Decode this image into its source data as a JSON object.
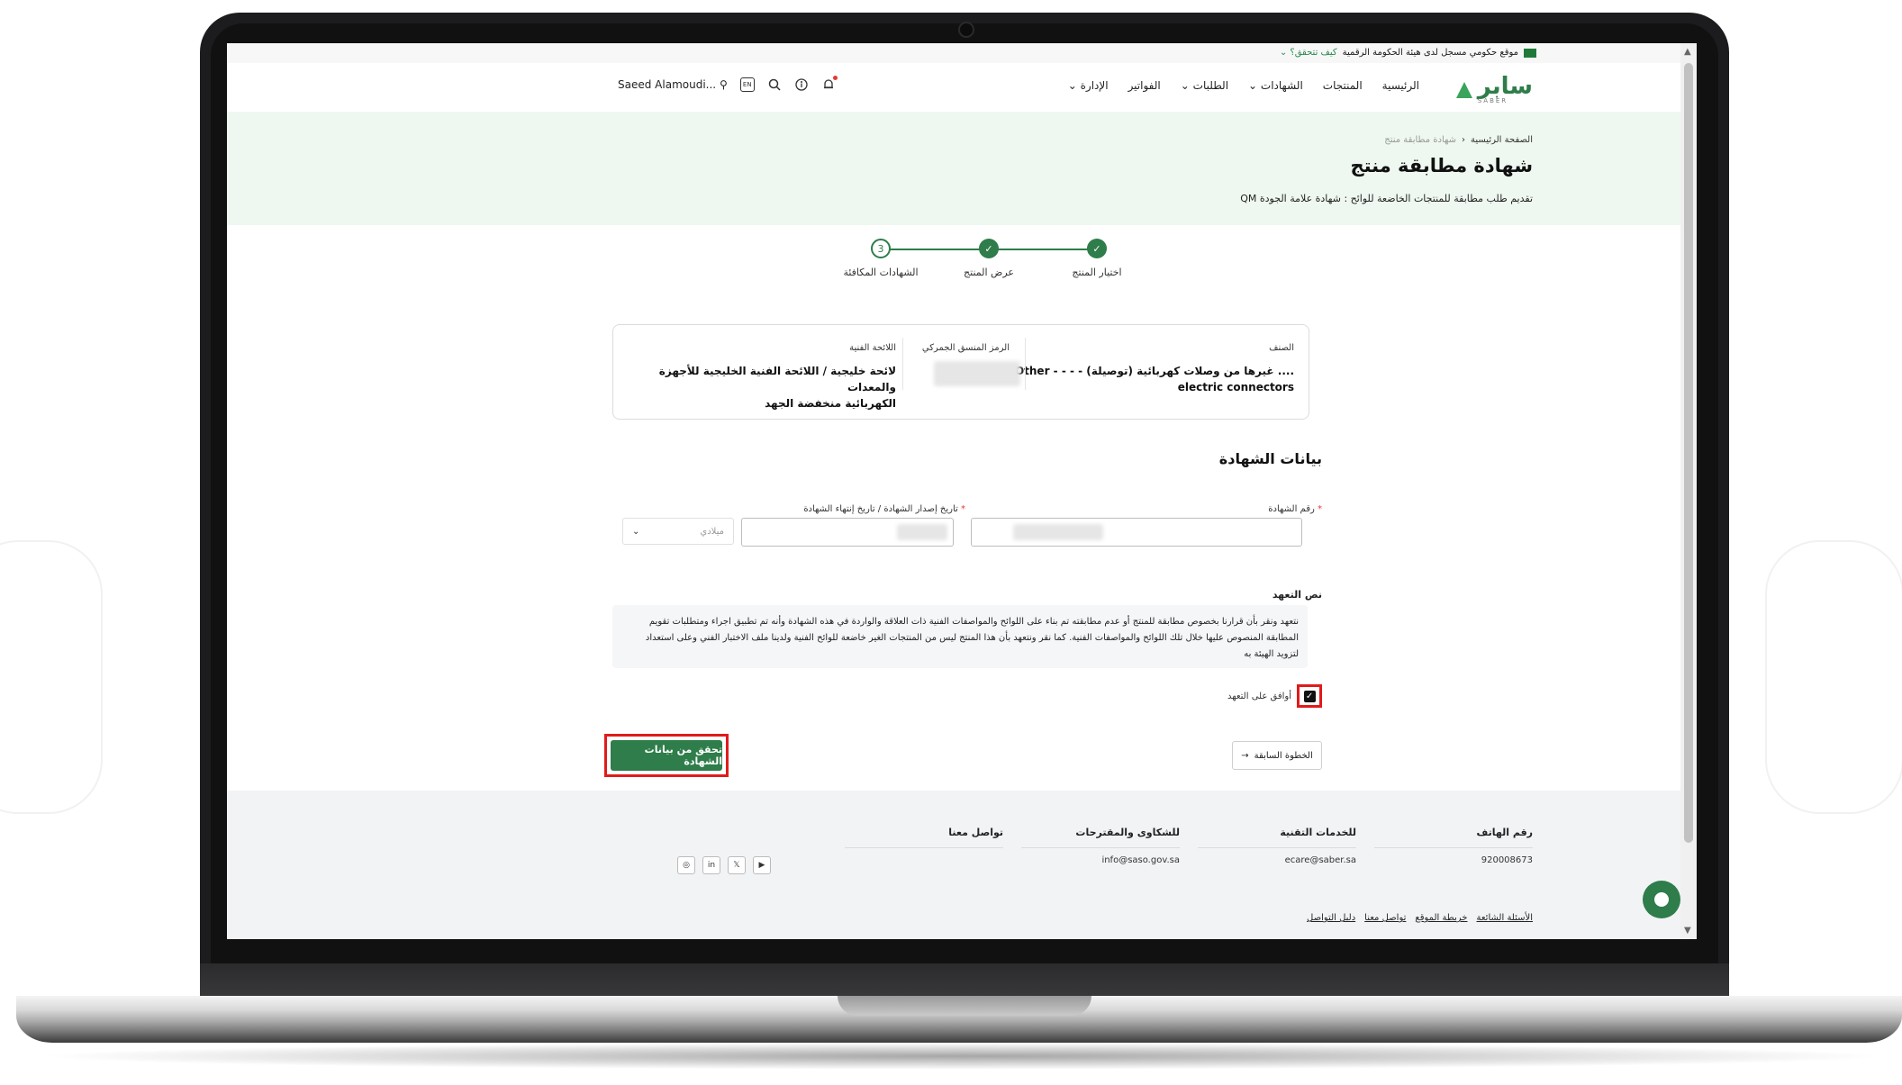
{
  "gov_bar": {
    "text": "موقع حكومي مسجل لدى هيئة الحكومة الرقمية",
    "link": "كيف تتحقق؟"
  },
  "nav": {
    "logo_text": "سابر",
    "logo_sub": "SABER",
    "menu": [
      "الرئيسية",
      "المنتجات",
      "الشهادات",
      "الطلبات",
      "الفواتير",
      "الإدارة"
    ],
    "user_name": "Saeed Alamoudi...",
    "lang": "EN"
  },
  "hero": {
    "breadcrumb_home": "الصفحة الرئيسية",
    "breadcrumb_sep": "‹",
    "breadcrumb_current": "شهادة مطابقة منتج",
    "title": "شهادة مطابقة منتج",
    "subtitle": "تقديم طلب مطابقة للمنتجات الخاضعة للوائح : شهادة علامة الجودة QM"
  },
  "stepper": {
    "steps": [
      {
        "label": "اختيار المنتج",
        "state": "done"
      },
      {
        "label": "عرض المنتج",
        "state": "done"
      },
      {
        "label": "الشهادات المكافئة",
        "state": "current",
        "number": "3"
      }
    ]
  },
  "product": {
    "class_label": "الصنف",
    "class_value_line1": ".... غيرها من وصلات كهربائية (توصيلة) - - - - Other",
    "class_value_line2": "electric connectors",
    "hs_label": "الرمز المنسق الجمركي",
    "regulation_label": "اللائحة الفنية",
    "regulation_value_line1": "لائحة خليجية / اللائحة الفنية الخليجية للأجهزة والمعدات",
    "regulation_value_line2": "الكهربائية منخفضة الجهد"
  },
  "form": {
    "section_title": "بيانات الشهادة",
    "required_mark": "*",
    "cert_number_label": "رقم الشهادة",
    "dates_label": "تاريخ إصدار الشهادة / تاريخ إنتهاء الشهادة",
    "calendar_value": "ميلادي",
    "pledge_title": "نص التعهد",
    "pledge_text": "نتعهد ونقر بأن قرارنا بخصوص مطابقة للمنتج أو عدم مطابقته تم بناء على اللوائح والمواصفات الفنية ذات العلاقة والواردة في هذه الشهادة وأنه تم تطبيق اجراء ومتطلبات تقويم المطابقة المنصوص عليها خلال تلك اللوائح والمواصفات الفنية. كما نقر ونتعهد بأن هذا المنتج ليس من المنتجات الغير خاضعة للوائح الفنية ولدينا ملف الاختبار الفني وعلى استعداد لتزويد الهيئة به",
    "agree_label": "أوافق على التعهد",
    "agree_checked": true,
    "verify_button": "تحقق من بيانات الشهادة",
    "prev_button": "الخطوة السابقة"
  },
  "footer": {
    "phone_title": "رقم الهاتف",
    "phone_value": "920008673",
    "tech_title": "للخدمات التقنية",
    "tech_value": "ecare@saber.sa",
    "complaints_title": "للشكاوى والمقترحات",
    "complaints_value": "info@saso.gov.sa",
    "contact_title": "تواصل معنا",
    "links": [
      "الأسئلة الشائعة",
      "خريطة الموقع",
      "تواصل معنا",
      "دليل التواصل"
    ]
  },
  "colors": {
    "brand_green": "#2e7d4a",
    "hero_bg": "#eef8f0",
    "highlight_red": "#e01b1b"
  }
}
